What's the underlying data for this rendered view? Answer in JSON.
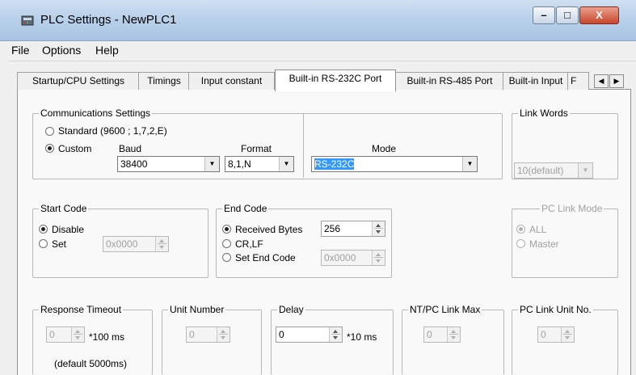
{
  "window": {
    "title": "PLC Settings - NewPLC1",
    "minimize_glyph": "–",
    "maximize_glyph": "□",
    "close_glyph": "X"
  },
  "menu": [
    "File",
    "Options",
    "Help"
  ],
  "tabs": [
    {
      "label": "Startup/CPU Settings"
    },
    {
      "label": "Timings"
    },
    {
      "label": "Input constant"
    },
    {
      "label": "Built-in RS-232C Port",
      "active": true
    },
    {
      "label": "Built-in RS-485 Port"
    },
    {
      "label": "Built-in Input"
    },
    {
      "label": "F"
    }
  ],
  "tab_scroll": {
    "left": "◀",
    "right": "▶"
  },
  "comm": {
    "group": "Communications Settings",
    "standard": "Standard (9600 ; 1,7,2,E)",
    "custom": "Custom",
    "baud_label": "Baud",
    "baud_value": "38400",
    "format_label": "Format",
    "format_value": "8,1,N",
    "mode_label": "Mode",
    "mode_value": "RS-232C"
  },
  "link_words": {
    "group": "Link Words",
    "value": "10(default)"
  },
  "start_code": {
    "group": "Start Code",
    "disable": "Disable",
    "set": "Set",
    "value": "0x0000"
  },
  "end_code": {
    "group": "End Code",
    "received_bytes": "Received Bytes",
    "received_value": "256",
    "crlf": "CR,LF",
    "set_end_code": "Set End Code",
    "end_value": "0x0000"
  },
  "pc_link_mode": {
    "group": "PC Link Mode",
    "all": "ALL",
    "master": "Master"
  },
  "response_timeout": {
    "group": "Response Timeout",
    "value": "0",
    "unit": "*100 ms",
    "default": "(default 5000ms)"
  },
  "unit_number": {
    "group": "Unit Number",
    "value": "0"
  },
  "delay": {
    "group": "Delay",
    "value": "0",
    "unit": "*10 ms"
  },
  "nt_pc_link_max": {
    "group": "NT/PC Link Max",
    "value": "0"
  },
  "pc_link_unit_no": {
    "group": "PC Link Unit No.",
    "value": "0"
  }
}
